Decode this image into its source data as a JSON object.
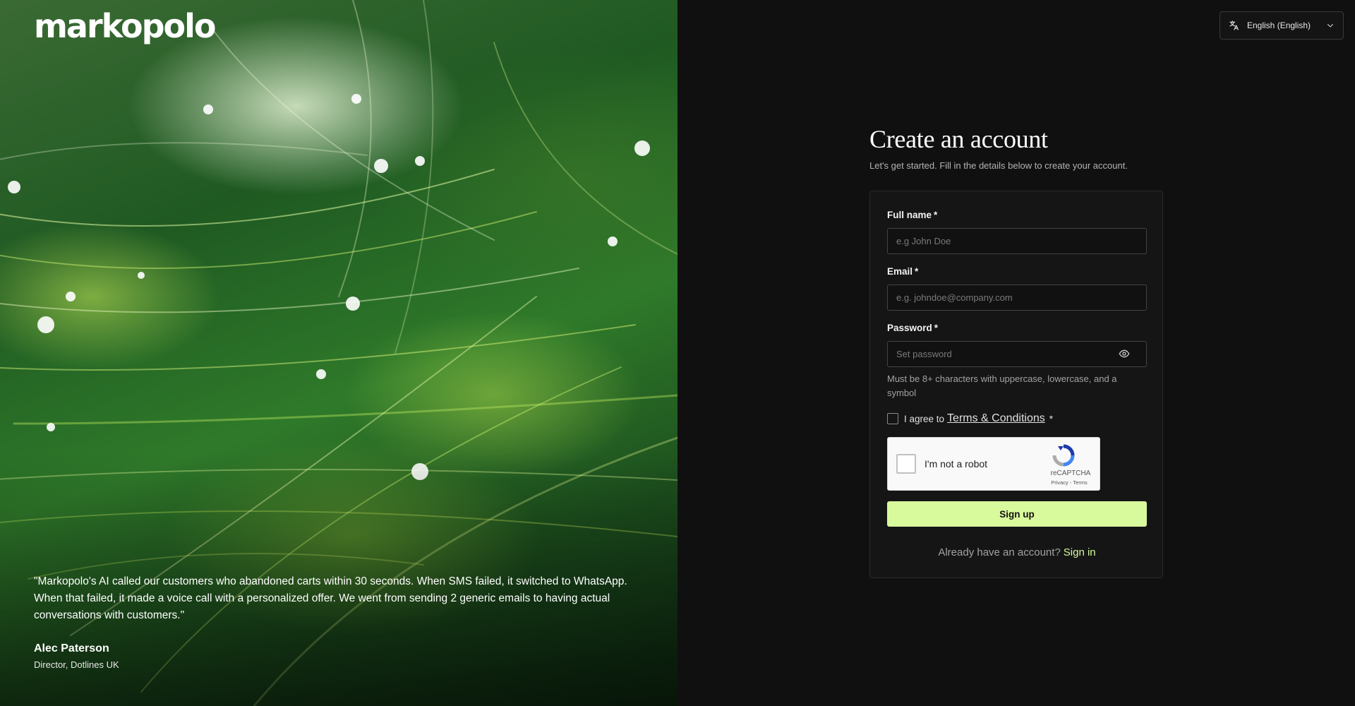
{
  "brand": {
    "logo": "markopolo"
  },
  "testimonial": {
    "quote": "\"Markopolo's AI called our customers who abandoned carts within 30 seconds. When SMS failed, it switched to WhatsApp. When that failed, it made a voice call with a personalized offer. We went from sending 2 generic emails to having actual conversations with customers.\"",
    "name": "Alec Paterson",
    "role": "Director, Dotlines UK"
  },
  "language": {
    "label": "English (English)",
    "icon": "translate-icon"
  },
  "header": {
    "title": "Create an account",
    "subtitle": "Let's get started. Fill in the details below to create your account."
  },
  "form": {
    "full_name": {
      "label": "Full name",
      "required": "*",
      "placeholder": "e.g John Doe",
      "value": ""
    },
    "email": {
      "label": "Email",
      "required": "*",
      "placeholder": "e.g. johndoe@company.com",
      "value": ""
    },
    "password": {
      "label": "Password",
      "required": "*",
      "placeholder": "Set password",
      "value": "",
      "hint": "Must be 8+ characters with uppercase, lowercase, and a symbol"
    },
    "terms": {
      "prefix": "I agree to",
      "link": "Terms & Conditions",
      "required": "*",
      "checked": false
    },
    "captcha": {
      "text": "I'm not a robot",
      "brand": "reCAPTCHA",
      "links": "Privacy - Terms"
    },
    "submit": "Sign up",
    "signin": {
      "prefix": "Already have an account?",
      "link": "Sign in"
    }
  },
  "colors": {
    "accent": "#d9f99d",
    "background": "#101010",
    "card": "#151515"
  }
}
